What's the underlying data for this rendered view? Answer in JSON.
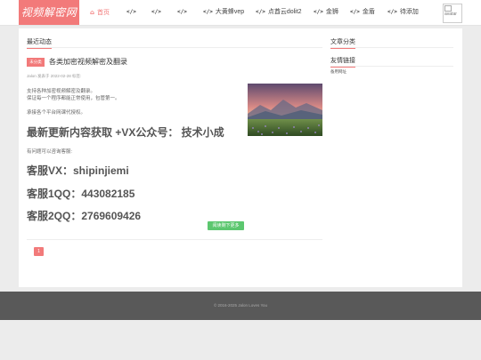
{
  "header": {
    "logo_text": "视频解密网",
    "nav": [
      {
        "icon": "home-icon",
        "glyph": "⌂",
        "label": "首页",
        "active": true
      },
      {
        "icon": "code-icon",
        "glyph": "</>",
        "label": ""
      },
      {
        "icon": "code-icon",
        "glyph": "</>",
        "label": ""
      },
      {
        "icon": "code-icon",
        "glyph": "</>",
        "label": ""
      },
      {
        "icon": "code-icon",
        "glyph": "</>",
        "label": "大黄蜂vep"
      },
      {
        "icon": "code-icon",
        "glyph": "</>",
        "label": "点酋云dolit2"
      },
      {
        "icon": "code-icon",
        "glyph": "</>",
        "label": "金狮"
      },
      {
        "icon": "code-icon",
        "glyph": "</>",
        "label": "金盾"
      },
      {
        "icon": "code-icon",
        "glyph": "</>",
        "label": "待添加"
      }
    ],
    "avatar_alt": "avatar"
  },
  "main": {
    "section_title": "最近动态",
    "post": {
      "category": "未分类",
      "title": "各类加密视频解密及翻录",
      "meta": "Jalon 发表于 2022-02-28    标签:",
      "intro_lines": [
        "支持各种加密视频解密及翻录。",
        "保证每一个程序都能正常使用，包管第一。"
      ],
      "service_line": "承接各个平台网课代授权。",
      "headline": "最新更新内容获取 +VX公众号： 技术小成",
      "contact_note": "有问题可以咨询客服:",
      "contacts": [
        "客服VX：shipinjiemi",
        "客服1QQ：443082185",
        "客服2QQ：2769609426"
      ],
      "read_more": "阅读剩下更多"
    },
    "pagination": {
      "current": "1"
    }
  },
  "sidebar": {
    "categories_title": "文章分类",
    "links_title": "友情链接",
    "links": [
      "备用网址"
    ]
  },
  "footer": {
    "copyright": "© 2016-2025 Jalon Loves You"
  },
  "colors": {
    "accent": "#f27a7a",
    "read_more": "#5cc76f",
    "footer_bg": "#595959"
  }
}
